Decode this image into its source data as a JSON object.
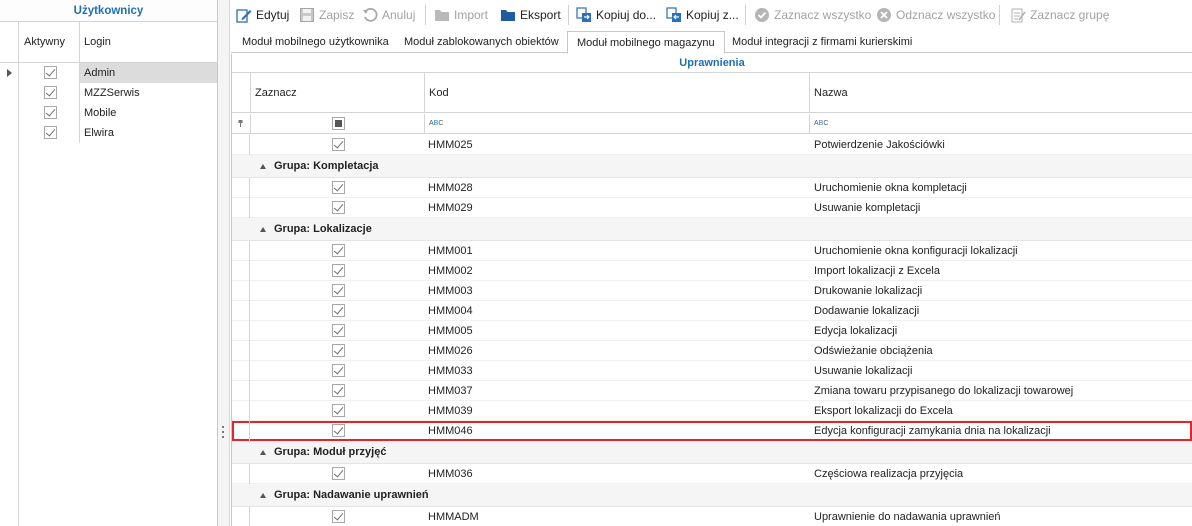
{
  "left_panel": {
    "title": "Użytkownicy",
    "columns": {
      "active": "Aktywny",
      "login": "Login"
    },
    "users": [
      {
        "login": "Admin",
        "active": true,
        "selected": true
      },
      {
        "login": "MZZSerwis",
        "active": true,
        "selected": false
      },
      {
        "login": "Mobile",
        "active": true,
        "selected": false
      },
      {
        "login": "Elwira",
        "active": true,
        "selected": false
      }
    ]
  },
  "toolbar": {
    "edit": "Edytuj",
    "save": "Zapisz",
    "cancel": "Anuluj",
    "import": "Import",
    "export": "Eksport",
    "copy_to": "Kopiuj do...",
    "copy_from": "Kopiuj z...",
    "select_all": "Zaznacz wszystko",
    "deselect_all": "Odznacz wszystko",
    "select_group": "Zaznacz grupę"
  },
  "tabs": [
    {
      "label": "Moduł mobilnego użytkownika",
      "active": false
    },
    {
      "label": "Moduł zablokowanych obiektów",
      "active": false
    },
    {
      "label": "Moduł mobilnego magazynu",
      "active": true
    },
    {
      "label": "Moduł integracji z firmami kurierskimi",
      "active": false
    }
  ],
  "grid": {
    "title": "Uprawnienia",
    "columns": {
      "select": "Zaznacz",
      "code": "Kod",
      "name": "Nazwa"
    },
    "filter_text_icon": "ABC",
    "rows": [
      {
        "type": "item",
        "code": "HMM025",
        "name": "Potwierdzenie Jakościówki",
        "checked": true
      },
      {
        "type": "group",
        "label": "Grupa: Kompletacja"
      },
      {
        "type": "item",
        "code": "HMM028",
        "name": "Uruchomienie okna kompletacji",
        "checked": true
      },
      {
        "type": "item",
        "code": "HMM029",
        "name": "Usuwanie kompletacji",
        "checked": true
      },
      {
        "type": "group",
        "label": "Grupa: Lokalizacje"
      },
      {
        "type": "item",
        "code": "HMM001",
        "name": "Uruchomienie okna konfiguracji lokalizacji",
        "checked": true
      },
      {
        "type": "item",
        "code": "HMM002",
        "name": "Import lokalizacji z Excela",
        "checked": true
      },
      {
        "type": "item",
        "code": "HMM003",
        "name": "Drukowanie lokalizacji",
        "checked": true
      },
      {
        "type": "item",
        "code": "HMM004",
        "name": "Dodawanie lokalizacji",
        "checked": true
      },
      {
        "type": "item",
        "code": "HMM005",
        "name": "Edycja lokalizacji",
        "checked": true
      },
      {
        "type": "item",
        "code": "HMM026",
        "name": "Odświeżanie obciążenia",
        "checked": true
      },
      {
        "type": "item",
        "code": "HMM033",
        "name": "Usuwanie lokalizacji",
        "checked": true
      },
      {
        "type": "item",
        "code": "HMM037",
        "name": "Zmiana towaru przypisanego do lokalizacji towarowej",
        "checked": true
      },
      {
        "type": "item",
        "code": "HMM039",
        "name": "Eksport lokalizacji do Excela",
        "checked": true
      },
      {
        "type": "item",
        "code": "HMM046",
        "name": "Edycja konfiguracji zamykania dnia na lokalizacji",
        "checked": true,
        "highlighted": true
      },
      {
        "type": "group",
        "label": "Grupa: Moduł przyjęć"
      },
      {
        "type": "item",
        "code": "HMM036",
        "name": "Częściowa realizacja przyjęcia",
        "checked": true
      },
      {
        "type": "group",
        "label": "Grupa: Nadawanie uprawnień"
      },
      {
        "type": "item",
        "code": "HMMADM",
        "name": "Uprawnienie do nadawania uprawnień",
        "checked": true
      }
    ]
  },
  "colors": {
    "accent": "#1e6fb3",
    "highlight": "#e0262a"
  }
}
